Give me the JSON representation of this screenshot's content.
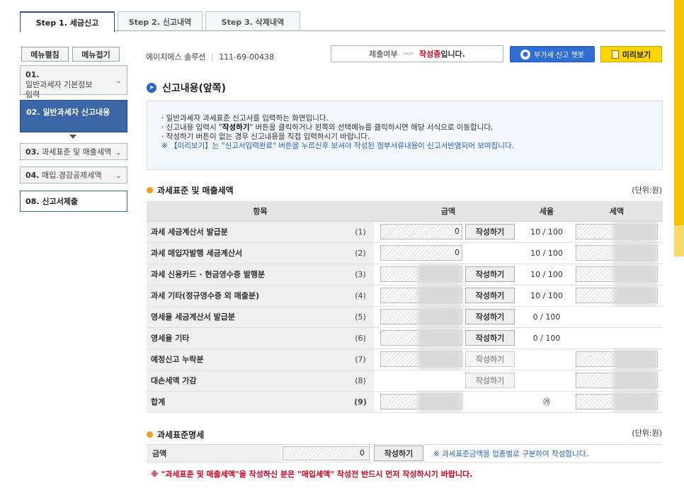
{
  "tabs": [
    "Step 1. 세금신고",
    "Step 2. 신고내역",
    "Step 3. 삭제내역"
  ],
  "left_nav": {
    "expand_label": "메뉴펼침",
    "collapse_label": "메뉴접기",
    "items": [
      {
        "num": "01.",
        "label": "일반과세자 기본정보 입력"
      },
      {
        "num": "02.",
        "label": "일반과세자 신고내용"
      },
      {
        "num": "03.",
        "label": "과세표준 및 매출세액"
      },
      {
        "num": "04.",
        "label": "매입.경감공제세액"
      },
      {
        "num": "08.",
        "label": "신고서제출"
      }
    ]
  },
  "header": {
    "company": "에이치에스 솔루션",
    "biz_no": "111-69-00438",
    "status_label": "제출여부",
    "status_arrows": "››››",
    "status_value": "작성중",
    "status_suffix": "입니다.",
    "chatbot_label": "부가세 신고 챗봇",
    "preview_label": "미리보기"
  },
  "section_title": "신고내용(앞쪽)",
  "info_lines": [
    "· 일반과세자 과세표준 신고서를 입력하는 화면입니다.",
    "· 작성하기 버튼이 없는 경우 신고내용을 직접 입력하시기 바랍니다.",
    "※ 【미리보기】는 \"신고서입력완료\" 버튼을 누르신후 보셔야 작성된 첨부서류내용이 신고서반영되어 보여집니다."
  ],
  "info_line2": {
    "prefix": "· 신고내용 입력시 \"",
    "bold": "작성하기",
    "suffix": "\" 버튼을 클릭하거나 왼쪽의 선택메뉴를 클릭하시면 해당 서식으로 이동합니다."
  },
  "sales_section": {
    "title": "과세표준 및 매출세액",
    "unit": "(단위:원)",
    "headers": [
      "항목",
      "금액",
      "세율",
      "세액"
    ],
    "rows": [
      {
        "item": "과세 세금계산서 발급분",
        "code": "(1)",
        "amount": "0",
        "button": "작성하기",
        "btn_state": "enabled",
        "rate": "10 / 100",
        "tax_input": true,
        "amt_input": true
      },
      {
        "item": "과세 매입자발행 세금계산서",
        "code": "(2)",
        "amount": "0",
        "button": "",
        "btn_state": "none",
        "rate": "10 / 100",
        "tax_input": true,
        "amt_input": true
      },
      {
        "item": "과세 신용카드 · 현금영수증 발행분",
        "code": "(3)",
        "amount": "",
        "button": "작성하기",
        "btn_state": "enabled",
        "rate": "10 / 100",
        "tax_input": true,
        "amt_input": true
      },
      {
        "item": "과세 기타(정규영수증 외 매출분)",
        "code": "(4)",
        "amount": "",
        "button": "작성하기",
        "btn_state": "enabled",
        "rate": "10 / 100",
        "tax_input": true,
        "amt_input": true
      },
      {
        "item": "영세율 세금계산서 발급분",
        "code": "(5)",
        "amount": "",
        "button": "작성하기",
        "btn_state": "enabled",
        "rate": "0 / 100",
        "tax_input": false,
        "amt_input": true
      },
      {
        "item": "영세율 기타",
        "code": "(6)",
        "amount": "",
        "button": "작성하기",
        "btn_state": "enabled",
        "rate": "0 / 100",
        "tax_input": false,
        "amt_input": true
      },
      {
        "item": "예정신고 누락분",
        "code": "(7)",
        "amount": "",
        "button": "작성하기",
        "btn_state": "disabled",
        "rate": "",
        "tax_input": true,
        "amt_input": true
      },
      {
        "item": "대손세액 가감",
        "code": "(8)",
        "amount": "",
        "button": "작성하기",
        "btn_state": "disabled",
        "rate": "",
        "tax_input": true,
        "amt_input": false
      },
      {
        "item": "합계",
        "code": "(9)",
        "amount": "",
        "button": "",
        "btn_state": "none",
        "rate": "㉮",
        "tax_input": true,
        "amt_input": true
      }
    ]
  },
  "taxbase_section": {
    "title": "과세표준명세",
    "unit": "(단위:원)",
    "label": "금액",
    "amount": "0",
    "button": "작성하기",
    "note": "※ 과세표준금액을 업종별로 구분하여 작성합니다."
  },
  "warning": "※ \"과세표준 및 매출세액\"을 작성하신 분은 \"매입세액\" 작성전 반드시 먼저 작성하시기 바랍니다.",
  "colors": {
    "accent_blue": "#3a66a8",
    "status_red": "#d6001c",
    "preview_yellow": "#ffd500",
    "bullet_orange": "#f0a020"
  }
}
